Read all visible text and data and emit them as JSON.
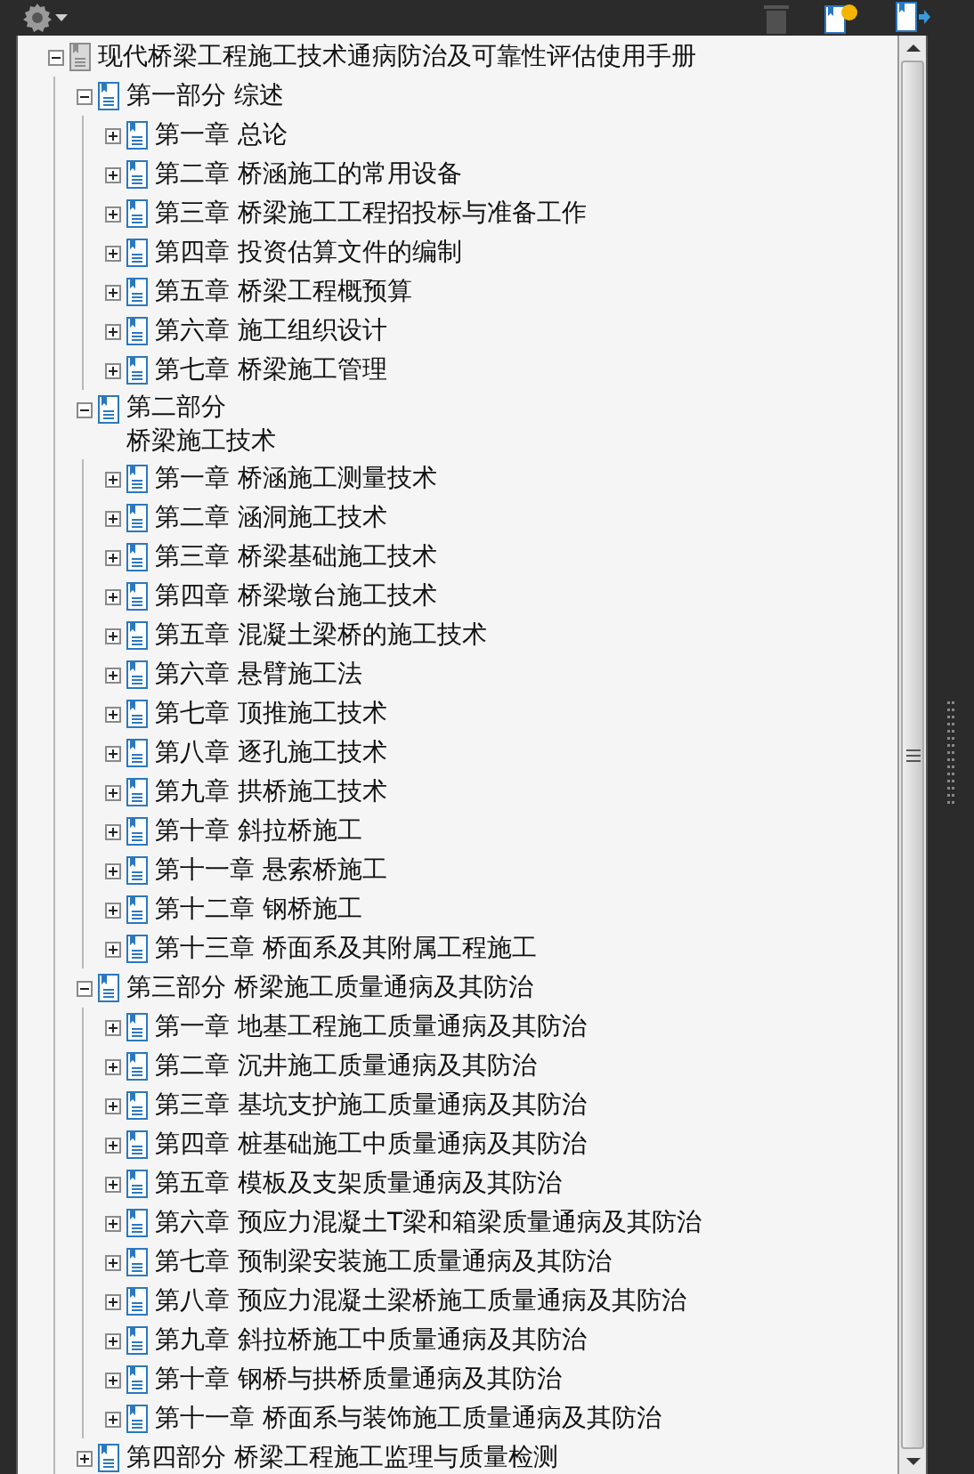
{
  "bookmarks": {
    "label": "现代桥梁工程施工技术通病防治及可靠性评估使用手册",
    "expanded": true,
    "children": [
      {
        "label": "第一部分 综述",
        "expanded": true,
        "children": [
          {
            "label": "第一章 总论",
            "expanded": false
          },
          {
            "label": "第二章 桥涵施工的常用设备",
            "expanded": false
          },
          {
            "label": "第三章 桥梁施工工程招投标与准备工作",
            "expanded": false
          },
          {
            "label": "第四章 投资估算文件的编制",
            "expanded": false
          },
          {
            "label": "第五章 桥梁工程概预算",
            "expanded": false
          },
          {
            "label": "第六章 施工组织设计",
            "expanded": false
          },
          {
            "label": "第七章 桥梁施工管理",
            "expanded": false
          }
        ]
      },
      {
        "label_lines": [
          "第二部分",
          "桥梁施工技术"
        ],
        "expanded": true,
        "children": [
          {
            "label": "第一章 桥涵施工测量技术",
            "expanded": false
          },
          {
            "label": "第二章 涵洞施工技术",
            "expanded": false
          },
          {
            "label": "第三章 桥梁基础施工技术",
            "expanded": false
          },
          {
            "label": "第四章 桥梁墩台施工技术",
            "expanded": false
          },
          {
            "label": "第五章 混凝土梁桥的施工技术",
            "expanded": false
          },
          {
            "label": "第六章 悬臂施工法",
            "expanded": false
          },
          {
            "label": "第七章 顶推施工技术",
            "expanded": false
          },
          {
            "label": "第八章 逐孔施工技术",
            "expanded": false
          },
          {
            "label": "第九章 拱桥施工技术",
            "expanded": false
          },
          {
            "label": "第十章 斜拉桥施工",
            "expanded": false
          },
          {
            "label": "第十一章 悬索桥施工",
            "expanded": false
          },
          {
            "label": "第十二章 钢桥施工",
            "expanded": false
          },
          {
            "label": "第十三章 桥面系及其附属工程施工",
            "expanded": false
          }
        ]
      },
      {
        "label": "第三部分 桥梁施工质量通病及其防治",
        "expanded": true,
        "children": [
          {
            "label": "第一章 地基工程施工质量通病及其防治",
            "expanded": false
          },
          {
            "label": "第二章 沉井施工质量通病及其防治",
            "expanded": false
          },
          {
            "label": "第三章 基坑支护施工质量通病及其防治",
            "expanded": false
          },
          {
            "label": "第四章 桩基础施工中质量通病及其防治",
            "expanded": false
          },
          {
            "label": "第五章 模板及支架质量通病及其防治",
            "expanded": false
          },
          {
            "label": "第六章 预应力混凝土T梁和箱梁质量通病及其防治",
            "expanded": false
          },
          {
            "label": "第七章 预制梁安装施工质量通病及其防治",
            "expanded": false
          },
          {
            "label": "第八章 预应力混凝土梁桥施工质量通病及其防治",
            "expanded": false
          },
          {
            "label": "第九章 斜拉桥施工中质量通病及其防治",
            "expanded": false
          },
          {
            "label": "第十章 钢桥与拱桥质量通病及其防治",
            "expanded": false
          },
          {
            "label": "第十一章 桥面系与装饰施工质量通病及其防治",
            "expanded": false
          }
        ]
      },
      {
        "label": "第四部分 桥梁工程施工监理与质量检测",
        "expanded": false
      }
    ]
  }
}
